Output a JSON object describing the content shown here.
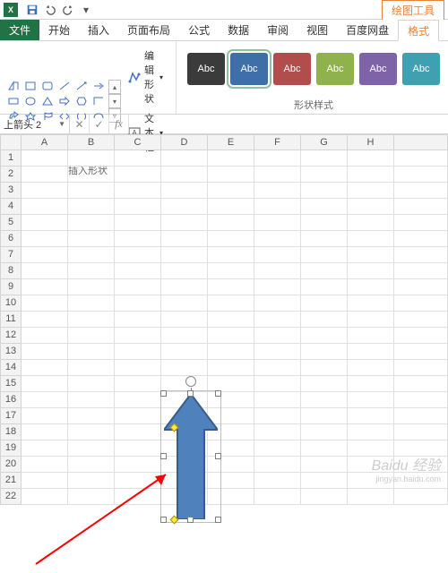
{
  "titlebar": {
    "tool_tab": "绘图工具"
  },
  "tabs": {
    "file": "文件",
    "home": "开始",
    "insert": "插入",
    "page_layout": "页面布局",
    "formulas": "公式",
    "data": "数据",
    "review": "审阅",
    "view": "视图",
    "baidu": "百度网盘",
    "format": "格式"
  },
  "ribbon": {
    "insert_shapes_label": "插入形状",
    "shape_styles_label": "形状样式",
    "edit_shape": "编辑形状",
    "text_box": "文本框",
    "swatch_text": "Abc",
    "swatch_colors": [
      "#3b3b3b",
      "#3f6fa8",
      "#b14d4d",
      "#8fb24d",
      "#7e63a8",
      "#3fa0b2"
    ],
    "selected_swatch": 1
  },
  "namebox": {
    "value": "上箭头 2"
  },
  "formula_bar": {
    "cancel": "✕",
    "confirm": "✓",
    "fx": "fx"
  },
  "columns": [
    "A",
    "B",
    "C",
    "D",
    "E",
    "F",
    "G",
    "H"
  ],
  "row_count": 22,
  "watermark": {
    "brand": "Baidu 经验",
    "url": "jingyan.baidu.com"
  }
}
